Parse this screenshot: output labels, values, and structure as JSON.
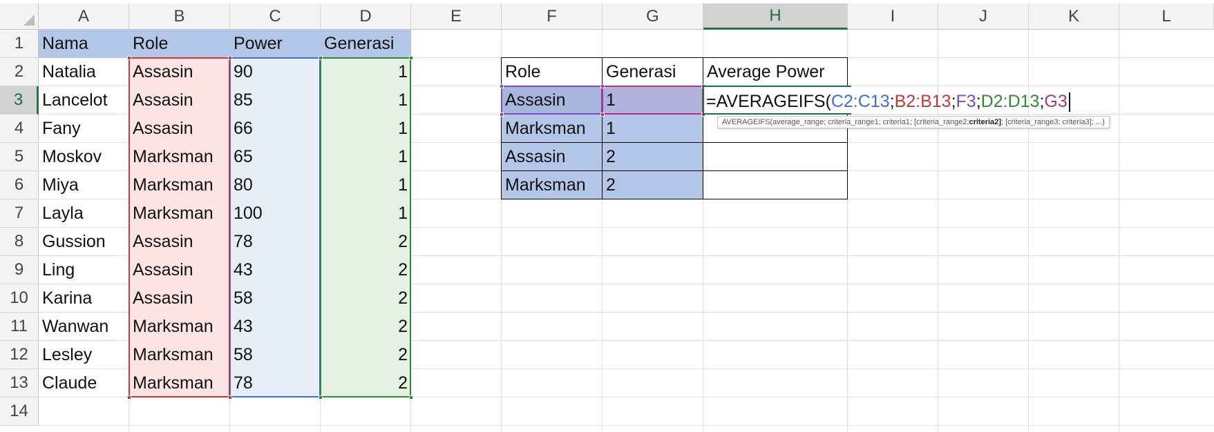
{
  "columns": [
    "A",
    "B",
    "C",
    "D",
    "E",
    "F",
    "G",
    "H",
    "I",
    "J",
    "K",
    "L"
  ],
  "active_column": "H",
  "rows": [
    "1",
    "2",
    "3",
    "4",
    "5",
    "6",
    "7",
    "8",
    "9",
    "10",
    "11",
    "12",
    "13",
    "14"
  ],
  "active_row": "3",
  "table1": {
    "headers": [
      "Nama",
      "Role",
      "Power",
      "Generasi"
    ],
    "rows": [
      [
        "Natalia",
        "Assasin",
        "90",
        "1"
      ],
      [
        "Lancelot",
        "Assasin",
        "85",
        "1"
      ],
      [
        "Fany",
        "Assasin",
        "66",
        "1"
      ],
      [
        "Moskov",
        "Marksman",
        "65",
        "1"
      ],
      [
        "Miya",
        "Marksman",
        "80",
        "1"
      ],
      [
        "Layla",
        "Marksman",
        "100",
        "1"
      ],
      [
        "Gussion",
        "Assasin",
        "78",
        "2"
      ],
      [
        "Ling",
        "Assasin",
        "43",
        "2"
      ],
      [
        "Karina",
        "Assasin",
        "58",
        "2"
      ],
      [
        "Wanwan",
        "Marksman",
        "43",
        "2"
      ],
      [
        "Lesley",
        "Marksman",
        "58",
        "2"
      ],
      [
        "Claude",
        "Marksman",
        "78",
        "2"
      ]
    ]
  },
  "table2": {
    "headers": [
      "Role",
      "Generasi",
      "Average Power"
    ],
    "rows": [
      [
        "Assasin",
        "1"
      ],
      [
        "Marksman",
        "1"
      ],
      [
        "Assasin",
        "2"
      ],
      [
        "Marksman",
        "2"
      ]
    ]
  },
  "formula": {
    "prefix": "=AVERAGEIFS(",
    "arg1": "C2:C13",
    "arg2": "B2:B13",
    "arg3": "F3",
    "arg4": "D2:D13",
    "arg5": "G3",
    "separator": ";"
  },
  "tooltip": {
    "before": "AVERAGEIFS(average_range; criteria_range1; criteria1; [criteria_range2; ",
    "bold": "criteria2]",
    "after": "; [criteria_range3; criteria3]; ...)"
  },
  "colors": {
    "header_fill": "#b4c6e7",
    "role_fill": "#fce4e4",
    "power_fill": "#e8eef8",
    "generasi_fill": "#e4f1e3",
    "ref_blue": "#3a6fd8",
    "ref_red": "#c0393b",
    "ref_purple": "#7a4bc1",
    "ref_green": "#2e8b34",
    "ref_magenta": "#b0357e",
    "excel_green": "#217346"
  }
}
